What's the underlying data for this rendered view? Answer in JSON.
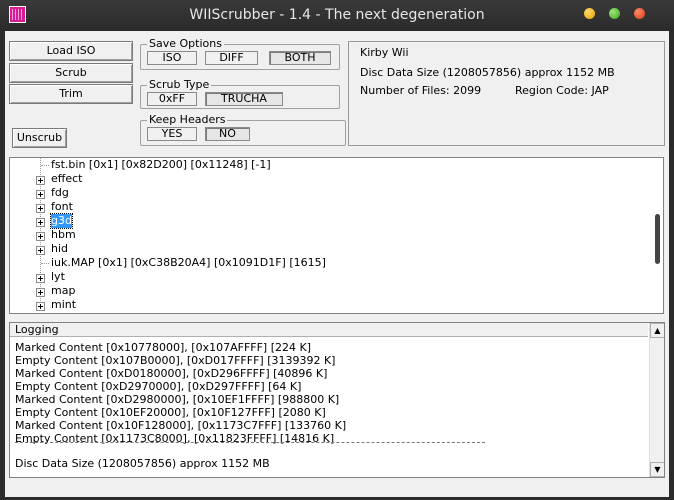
{
  "window": {
    "title": "WIIScrubber - 1.4 - The next degeneration"
  },
  "buttons": {
    "load_iso": "Load ISO",
    "scrub": "Scrub",
    "trim": "Trim",
    "unscrub": "Unscrub"
  },
  "save_options": {
    "label": "Save Options",
    "options": [
      "ISO",
      "DIFF",
      "BOTH"
    ],
    "selected": "BOTH"
  },
  "scrub_type": {
    "label": "Scrub Type",
    "options": [
      "0xFF",
      "TRUCHA"
    ],
    "selected": "TRUCHA"
  },
  "keep_headers": {
    "label": "Keep Headers",
    "options": [
      "YES",
      "NO"
    ],
    "selected": "NO"
  },
  "disc_info": {
    "game_name": "Kirby Wii",
    "disc_data_size": "Disc Data Size (1208057856) approx  1152 MB",
    "number_of_files": "Number of Files: 2099",
    "region_code": "Region Code: JAP"
  },
  "tree": {
    "items": [
      {
        "label": "fst.bin [0x1] [0x82D200] [0x11248] [-1]",
        "expandable": false
      },
      {
        "label": "effect",
        "expandable": true
      },
      {
        "label": "fdg",
        "expandable": true
      },
      {
        "label": "font",
        "expandable": true
      },
      {
        "label": "g3d",
        "expandable": true,
        "selected": true
      },
      {
        "label": "hbm",
        "expandable": true
      },
      {
        "label": "hid",
        "expandable": true
      },
      {
        "label": "iuk.MAP [0x1] [0xC38B20A4] [0x1091D1F] [1615]",
        "expandable": false
      },
      {
        "label": "lyt",
        "expandable": true
      },
      {
        "label": "map",
        "expandable": true
      },
      {
        "label": "mint",
        "expandable": true
      }
    ]
  },
  "logging": {
    "header": "Logging",
    "lines": [
      "Marked Content [0x10778000], [0x107AFFFF] [224 K]",
      "Empty Content [0x107B0000], [0xD017FFFF] [3139392 K]",
      "Marked Content [0xD0180000], [0xD296FFFF] [40896 K]",
      "Empty Content [0xD2970000], [0xD297FFFF] [64 K]",
      "Marked Content [0xD2980000], [0x10EF1FFFF] [988800 K]",
      "Empty Content [0x10EF20000], [0x10F127FFF] [2080 K]",
      "Marked Content [0x10F128000], [0x1173C7FFF] [133760 K]",
      "Empty Content [0x1173C8000], [0x11823FFFF] [14816 K]"
    ],
    "summary": "Disc Data Size (1208057856) approx  1152 MB"
  }
}
